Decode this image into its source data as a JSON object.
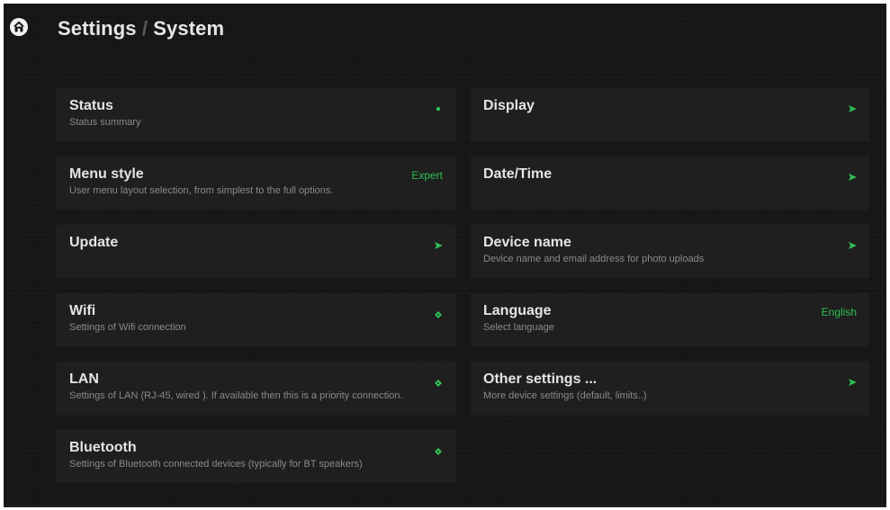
{
  "header": {
    "home_icon": "home-icon",
    "title_part1": "Settings",
    "title_separator": "/",
    "title_part2": "System"
  },
  "colors": {
    "accent_green": "#2fbf55",
    "card_bg": "#1f1f1f",
    "screen_bg": "#161616",
    "title_text": "#e6e6e6",
    "desc_text": "#8a8a8a"
  },
  "items": [
    {
      "title": "Status",
      "desc": "Status summary",
      "indicator": "dot-icon",
      "value": ""
    },
    {
      "title": "Display",
      "desc": "",
      "indicator": "arrow-right-icon",
      "value": ""
    },
    {
      "title": "Menu style",
      "desc": "User menu layout selection, from simplest to the full options.",
      "indicator": "value",
      "value": "Expert"
    },
    {
      "title": "Date/Time",
      "desc": "",
      "indicator": "arrow-right-icon",
      "value": ""
    },
    {
      "title": "Update",
      "desc": "",
      "indicator": "arrow-right-icon",
      "value": ""
    },
    {
      "title": "Device name",
      "desc": "Device name and email address for photo uploads",
      "indicator": "arrow-right-icon",
      "value": ""
    },
    {
      "title": "Wifi",
      "desc": "Settings of Wifi connection",
      "indicator": "diamond-icon",
      "value": ""
    },
    {
      "title": "Language",
      "desc": "Select language",
      "indicator": "value",
      "value": "English"
    },
    {
      "title": "LAN",
      "desc": "Settings of LAN (RJ-45, wired ). If available then this is a priority connection.",
      "indicator": "diamond-icon",
      "value": ""
    },
    {
      "title": "Other settings ...",
      "desc": "More device settings (default, limits..)",
      "indicator": "arrow-right-icon",
      "value": ""
    },
    {
      "title": "Bluetooth",
      "desc": "Settings of Bluetooth connected devices (typically for BT speakers)",
      "indicator": "diamond-icon",
      "value": ""
    }
  ]
}
